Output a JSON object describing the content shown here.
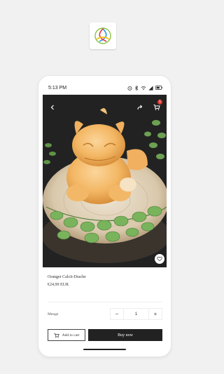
{
  "status_bar": {
    "time": "5:13 PM"
  },
  "colors": {
    "buy_now_bg": "#222222",
    "cart_badge": "#e53935",
    "page_bg": "#f1f1f1"
  },
  "header": {
    "back_icon": "chevron-left-icon",
    "share_icon": "share-icon",
    "cart_icon": "cart-icon",
    "cart_count": "1"
  },
  "product": {
    "name": "Oranger Calcit-Drache",
    "price": "€24,99 EUR"
  },
  "quantity": {
    "label": "Menge",
    "value": "1",
    "minus": "−",
    "plus": "+"
  },
  "actions": {
    "add_to_cart": "Add to cart",
    "buy_now": "Buy now"
  }
}
